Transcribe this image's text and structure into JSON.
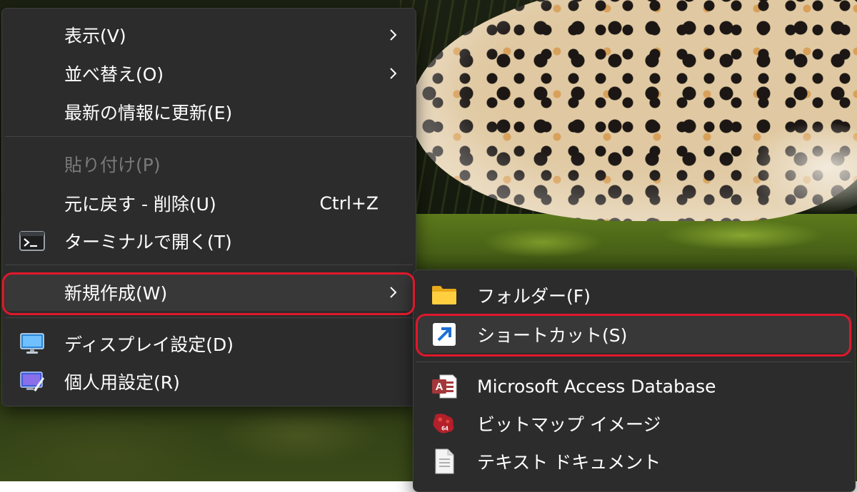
{
  "context_menu": {
    "items": [
      {
        "label": "表示(V)",
        "has_submenu": true
      },
      {
        "label": "並べ替え(O)",
        "has_submenu": true
      },
      {
        "label": "最新の情報に更新(E)"
      },
      {
        "label": "貼り付け(P)",
        "disabled": true
      },
      {
        "label": "元に戻す - 削除(U)",
        "shortcut": "Ctrl+Z"
      },
      {
        "label": "ターミナルで開く(T)",
        "icon": "terminal-icon"
      },
      {
        "label": "新規作成(W)",
        "has_submenu": true,
        "highlighted": true
      },
      {
        "label": "ディスプレイ設定(D)",
        "icon": "display-monitor-icon"
      },
      {
        "label": "個人用設定(R)",
        "icon": "personalize-icon"
      }
    ]
  },
  "new_submenu": {
    "items": [
      {
        "label": "フォルダー(F)",
        "icon": "folder-icon"
      },
      {
        "label": "ショートカット(S)",
        "icon": "shortcut-arrow-icon",
        "highlighted": true
      },
      {
        "label": "Microsoft Access Database",
        "icon": "access-database-icon"
      },
      {
        "label": "ビットマップ イメージ",
        "icon": "bitmap-paint-icon"
      },
      {
        "label": "テキスト ドキュメント",
        "icon": "text-document-icon"
      }
    ]
  },
  "colors": {
    "menu_bg": "#2c2c2c",
    "highlight_outline": "#e0172b",
    "disabled_text": "#7a7a7a"
  }
}
